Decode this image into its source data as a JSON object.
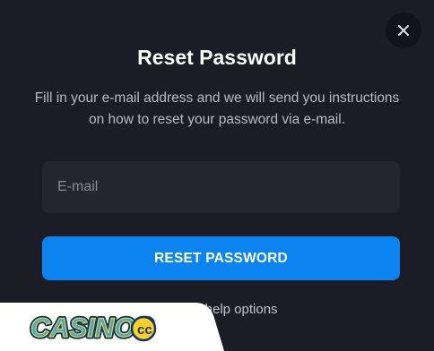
{
  "modal": {
    "title": "Reset Password",
    "description": "Fill in your e-mail address and we will send you instructions on how to reset your password via e-mail.",
    "email_placeholder": "E-mail",
    "email_value": "",
    "reset_button_label": "RESET PASSWORD",
    "help_link_label": "Back to help options",
    "close_icon": "close-icon"
  },
  "watermark": {
    "brand_text": "CASINOS",
    "suffix_text": "cc"
  },
  "colors": {
    "background": "#1b1c25",
    "input_background": "#24252f",
    "accent": "#0b84f2",
    "title_text": "#ffffff",
    "body_text": "#b9bac4"
  }
}
